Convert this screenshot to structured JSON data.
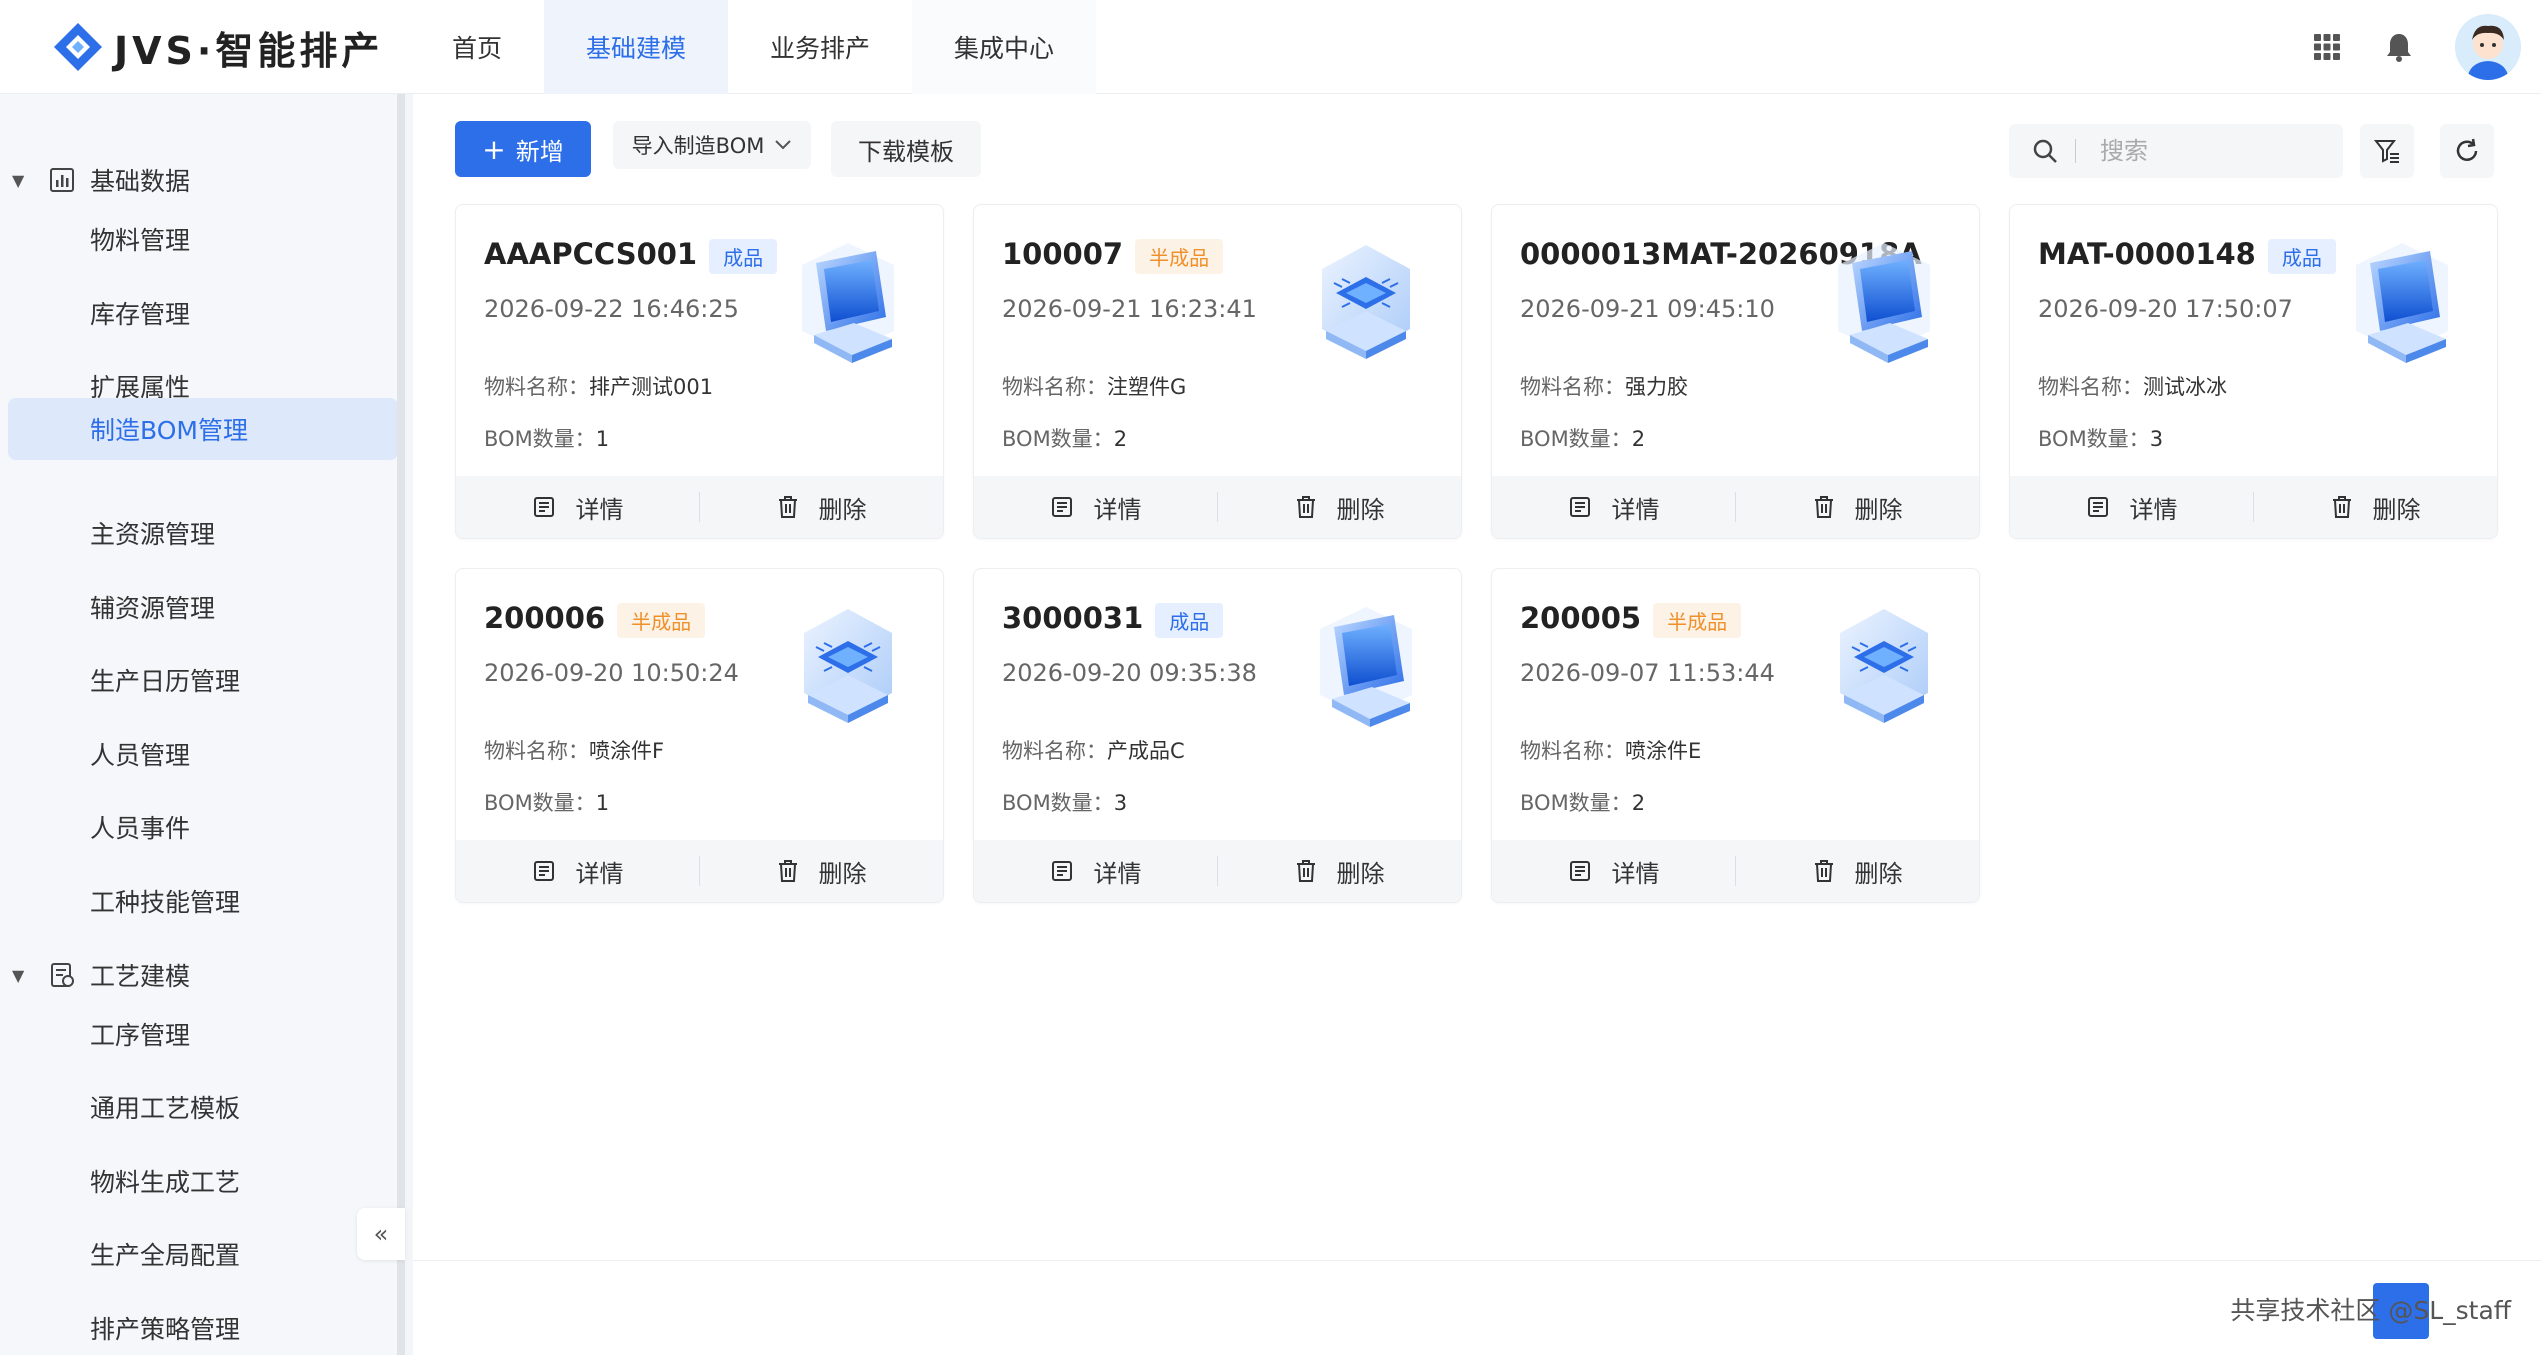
{
  "app": {
    "title": "JVS·智能排产"
  },
  "nav": {
    "items": [
      {
        "label": "首页"
      },
      {
        "label": "基础建模",
        "active": true
      },
      {
        "label": "业务排产"
      },
      {
        "label": "集成中心"
      }
    ]
  },
  "header_icons": [
    "apps-grid-icon",
    "bell-icon",
    "avatar"
  ],
  "sidebar": {
    "groups": [
      {
        "label": "基础数据",
        "icon": "chart-icon",
        "items": [
          "物料管理",
          "库存管理",
          "扩展属性",
          "制造BOM管理",
          "主资源管理",
          "辅资源管理",
          "生产日历管理",
          "人员管理",
          "人员事件",
          "工种技能管理"
        ]
      },
      {
        "label": "工艺建模",
        "icon": "process-icon",
        "items": [
          "工序管理",
          "通用工艺模板",
          "物料生成工艺",
          "生产全局配置",
          "排产策略管理"
        ]
      }
    ],
    "active_item": "制造BOM管理",
    "collapse_label": "«"
  },
  "toolbar": {
    "add_label": "新增",
    "import_label": "导入制造BOM",
    "template_label": "下载模板",
    "search_placeholder": "搜索"
  },
  "card_labels": {
    "name_prefix": "物料名称：",
    "bom_prefix": "BOM数量：",
    "detail": "详情",
    "delete": "删除"
  },
  "cards": [
    {
      "code": "AAAPCCS001",
      "tag": "成品",
      "tag_type": "finished",
      "time": "2026-09-22 16:46:25",
      "name": "排产测试001",
      "bom": "1",
      "image": "monitor"
    },
    {
      "code": "100007",
      "tag": "半成品",
      "tag_type": "semi",
      "time": "2026-09-21 16:23:41",
      "name": "注塑件G",
      "bom": "2",
      "image": "chip"
    },
    {
      "code": "0000013MAT-20260918A",
      "tag": "",
      "tag_type": "finished",
      "time": "2026-09-21 09:45:10",
      "name": "强力胶",
      "bom": "2",
      "image": "monitor"
    },
    {
      "code": "MAT-0000148",
      "tag": "成品",
      "tag_type": "finished",
      "time": "2026-09-20 17:50:07",
      "name": "测试冰冰",
      "bom": "3",
      "image": "monitor"
    },
    {
      "code": "200006",
      "tag": "半成品",
      "tag_type": "semi",
      "time": "2026-09-20 10:50:24",
      "name": "喷涂件F",
      "bom": "1",
      "image": "chip"
    },
    {
      "code": "3000031",
      "tag": "成品",
      "tag_type": "finished",
      "time": "2026-09-20 09:35:38",
      "name": "产成品C",
      "bom": "3",
      "image": "monitor"
    },
    {
      "code": "200005",
      "tag": "半成品",
      "tag_type": "semi",
      "time": "2026-09-07 11:53:44",
      "name": "喷涂件E",
      "bom": "2",
      "image": "chip"
    }
  ],
  "watermark": "共享技术社区 @SL_staff",
  "colors": {
    "primary": "#2d6fe8",
    "semi_tag": "#f0902a",
    "finished_tag_bg": "#e6efff"
  }
}
